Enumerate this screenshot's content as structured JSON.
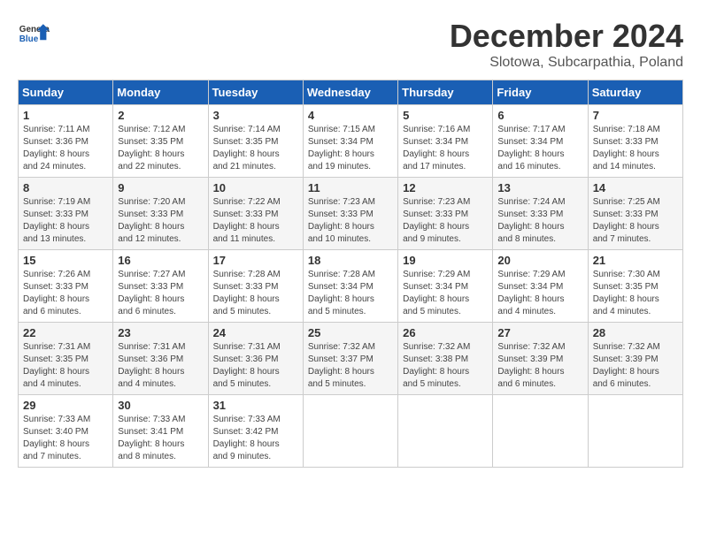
{
  "header": {
    "logo_general": "General",
    "logo_blue": "Blue",
    "month_title": "December 2024",
    "subtitle": "Slotowa, Subcarpathia, Poland"
  },
  "days_of_week": [
    "Sunday",
    "Monday",
    "Tuesday",
    "Wednesday",
    "Thursday",
    "Friday",
    "Saturday"
  ],
  "weeks": [
    [
      {
        "day": "1",
        "sunrise": "7:11 AM",
        "sunset": "3:36 PM",
        "daylight": "8 hours and 24 minutes."
      },
      {
        "day": "2",
        "sunrise": "7:12 AM",
        "sunset": "3:35 PM",
        "daylight": "8 hours and 22 minutes."
      },
      {
        "day": "3",
        "sunrise": "7:14 AM",
        "sunset": "3:35 PM",
        "daylight": "8 hours and 21 minutes."
      },
      {
        "day": "4",
        "sunrise": "7:15 AM",
        "sunset": "3:34 PM",
        "daylight": "8 hours and 19 minutes."
      },
      {
        "day": "5",
        "sunrise": "7:16 AM",
        "sunset": "3:34 PM",
        "daylight": "8 hours and 17 minutes."
      },
      {
        "day": "6",
        "sunrise": "7:17 AM",
        "sunset": "3:34 PM",
        "daylight": "8 hours and 16 minutes."
      },
      {
        "day": "7",
        "sunrise": "7:18 AM",
        "sunset": "3:33 PM",
        "daylight": "8 hours and 14 minutes."
      }
    ],
    [
      {
        "day": "8",
        "sunrise": "7:19 AM",
        "sunset": "3:33 PM",
        "daylight": "8 hours and 13 minutes."
      },
      {
        "day": "9",
        "sunrise": "7:20 AM",
        "sunset": "3:33 PM",
        "daylight": "8 hours and 12 minutes."
      },
      {
        "day": "10",
        "sunrise": "7:22 AM",
        "sunset": "3:33 PM",
        "daylight": "8 hours and 11 minutes."
      },
      {
        "day": "11",
        "sunrise": "7:23 AM",
        "sunset": "3:33 PM",
        "daylight": "8 hours and 10 minutes."
      },
      {
        "day": "12",
        "sunrise": "7:23 AM",
        "sunset": "3:33 PM",
        "daylight": "8 hours and 9 minutes."
      },
      {
        "day": "13",
        "sunrise": "7:24 AM",
        "sunset": "3:33 PM",
        "daylight": "8 hours and 8 minutes."
      },
      {
        "day": "14",
        "sunrise": "7:25 AM",
        "sunset": "3:33 PM",
        "daylight": "8 hours and 7 minutes."
      }
    ],
    [
      {
        "day": "15",
        "sunrise": "7:26 AM",
        "sunset": "3:33 PM",
        "daylight": "8 hours and 6 minutes."
      },
      {
        "day": "16",
        "sunrise": "7:27 AM",
        "sunset": "3:33 PM",
        "daylight": "8 hours and 6 minutes."
      },
      {
        "day": "17",
        "sunrise": "7:28 AM",
        "sunset": "3:33 PM",
        "daylight": "8 hours and 5 minutes."
      },
      {
        "day": "18",
        "sunrise": "7:28 AM",
        "sunset": "3:34 PM",
        "daylight": "8 hours and 5 minutes."
      },
      {
        "day": "19",
        "sunrise": "7:29 AM",
        "sunset": "3:34 PM",
        "daylight": "8 hours and 5 minutes."
      },
      {
        "day": "20",
        "sunrise": "7:29 AM",
        "sunset": "3:34 PM",
        "daylight": "8 hours and 4 minutes."
      },
      {
        "day": "21",
        "sunrise": "7:30 AM",
        "sunset": "3:35 PM",
        "daylight": "8 hours and 4 minutes."
      }
    ],
    [
      {
        "day": "22",
        "sunrise": "7:31 AM",
        "sunset": "3:35 PM",
        "daylight": "8 hours and 4 minutes."
      },
      {
        "day": "23",
        "sunrise": "7:31 AM",
        "sunset": "3:36 PM",
        "daylight": "8 hours and 4 minutes."
      },
      {
        "day": "24",
        "sunrise": "7:31 AM",
        "sunset": "3:36 PM",
        "daylight": "8 hours and 5 minutes."
      },
      {
        "day": "25",
        "sunrise": "7:32 AM",
        "sunset": "3:37 PM",
        "daylight": "8 hours and 5 minutes."
      },
      {
        "day": "26",
        "sunrise": "7:32 AM",
        "sunset": "3:38 PM",
        "daylight": "8 hours and 5 minutes."
      },
      {
        "day": "27",
        "sunrise": "7:32 AM",
        "sunset": "3:39 PM",
        "daylight": "8 hours and 6 minutes."
      },
      {
        "day": "28",
        "sunrise": "7:32 AM",
        "sunset": "3:39 PM",
        "daylight": "8 hours and 6 minutes."
      }
    ],
    [
      {
        "day": "29",
        "sunrise": "7:33 AM",
        "sunset": "3:40 PM",
        "daylight": "8 hours and 7 minutes."
      },
      {
        "day": "30",
        "sunrise": "7:33 AM",
        "sunset": "3:41 PM",
        "daylight": "8 hours and 8 minutes."
      },
      {
        "day": "31",
        "sunrise": "7:33 AM",
        "sunset": "3:42 PM",
        "daylight": "8 hours and 9 minutes."
      },
      null,
      null,
      null,
      null
    ]
  ],
  "labels": {
    "sunrise": "Sunrise:",
    "sunset": "Sunset:",
    "daylight": "Daylight:"
  }
}
